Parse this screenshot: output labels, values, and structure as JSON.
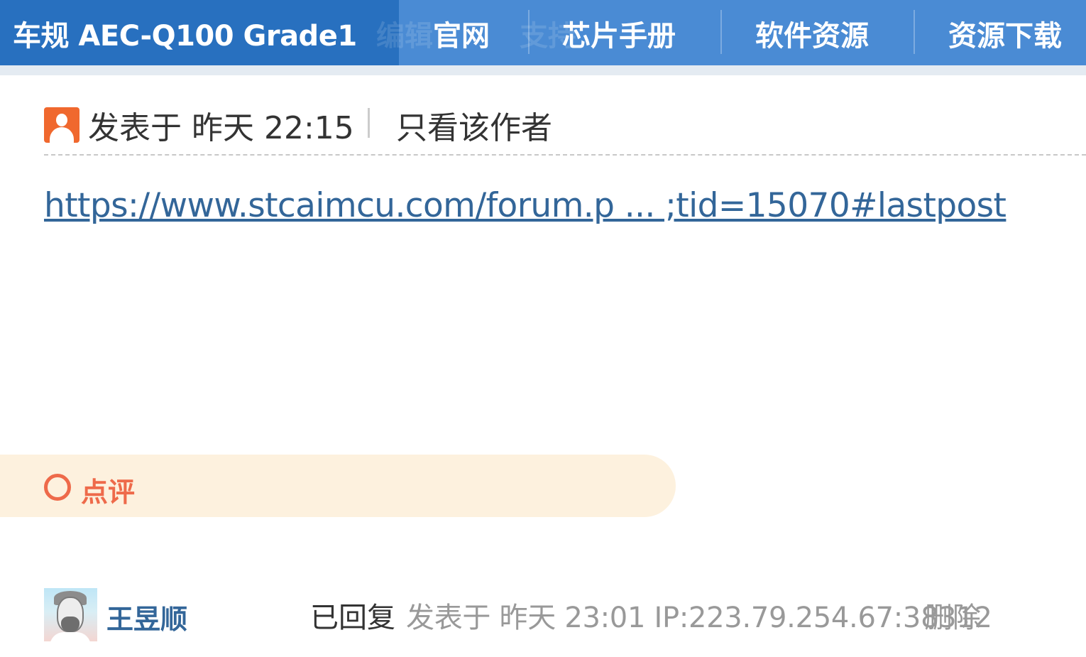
{
  "nav": {
    "site_title": "车规 AEC-Q100 Grade1",
    "ghost_left": "编辑",
    "ghost_right": "支持",
    "items": [
      "官网",
      "芯片手册",
      "软件资源",
      "资源下载"
    ]
  },
  "post": {
    "meta": "发表于 昨天 22:15",
    "only_author": "只看该作者",
    "link_text": "https://www.stcaimcu.com/forum.p ... ;tid=15070#lastpost"
  },
  "comment": {
    "label": "点评"
  },
  "reply": {
    "username": "王昱顺",
    "status": "已回复",
    "meta": "发表于 昨天 23:01 IP:223.79.254.67:38312",
    "delete_label": "删除"
  },
  "colors": {
    "nav_bg": "#4a8bd4",
    "title_bg": "#2870bf",
    "link": "#336699",
    "comment_bg": "#fdf1de",
    "comment_accent": "#ee6a4a",
    "author_icon": "#f0682e",
    "muted_text": "#999999"
  },
  "icons": {
    "author": "user-avatar-icon",
    "comment": "comment-circle-icon",
    "reply_avatar": "user-avatar-photo"
  }
}
